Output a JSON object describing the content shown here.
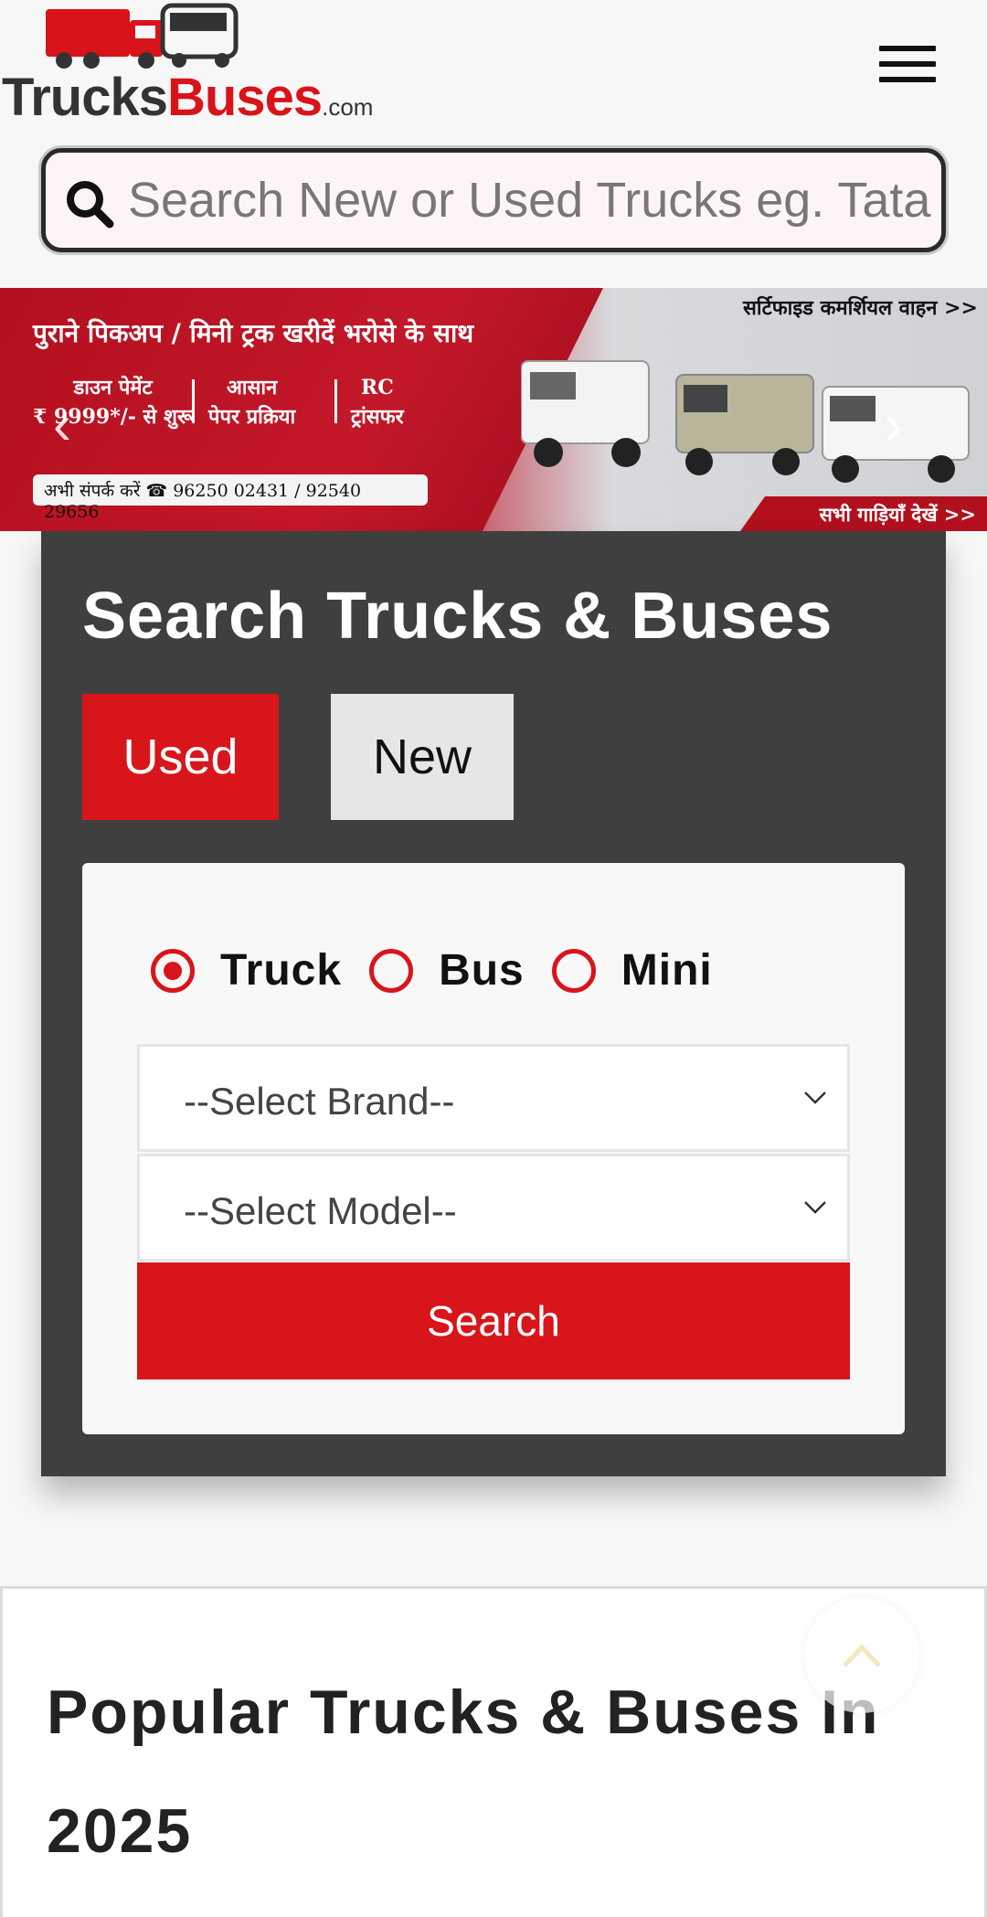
{
  "header": {
    "logo_part1": "Trucks",
    "logo_part2": "Buses",
    "logo_part3": ".com",
    "menu_icon": "hamburger-icon"
  },
  "search": {
    "placeholder": "Search New or Used Trucks eg. Tata",
    "icon": "search-icon"
  },
  "banner": {
    "heading": "पुराने पिकअप / मिनी ट्रक खरीदें भरोसे के साथ",
    "tag_right": "सर्टिफाइड कमर्शियल वाहन >>",
    "col1_line1": "डाउन पेमेंट",
    "col1_line2": "₹ 9999*/- से शुरू",
    "col2_line1": "आसान",
    "col2_line2": "पेपर प्रक्रिया",
    "col3_line1": "RC",
    "col3_line2": "ट्रांसफर",
    "phone": "अभी संपर्क करें ☎ 96250 02431 / 92540 29656",
    "view_all": "सभी गाड़ियाँ देखें >>",
    "prev": "‹",
    "next": "›"
  },
  "search_card": {
    "title": "Search Trucks & Buses",
    "tab_used": "Used",
    "tab_new": "New",
    "radio_truck": "Truck",
    "radio_bus": "Bus",
    "radio_mini": "Mini",
    "select_brand": "--Select  Brand--",
    "select_model": "--Select  Model--",
    "search_button": "Search"
  },
  "popular": {
    "title": "Popular Trucks & Buses In 2025"
  },
  "colors": {
    "brand_red": "#d8151b",
    "card_dark": "#3f3f3f"
  }
}
